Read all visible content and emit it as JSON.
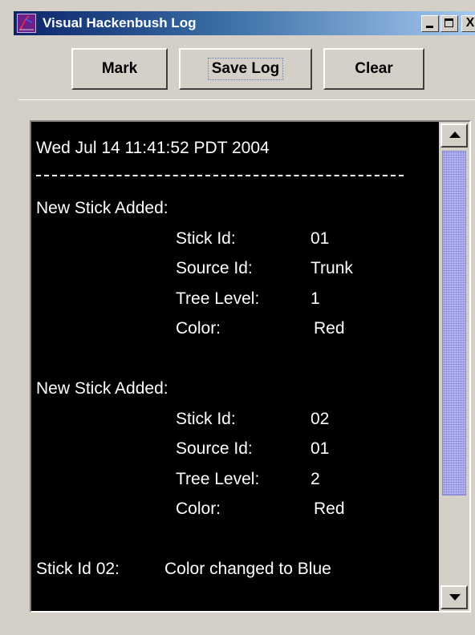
{
  "window": {
    "title": "Visual Hackenbush Log",
    "controls": {
      "minimize": "_",
      "maximize": "□",
      "close": "X"
    },
    "icon": "app-icon"
  },
  "toolbar": {
    "mark_label": "Mark",
    "save_label": "Save Log",
    "clear_label": "Clear"
  },
  "log": {
    "timestamp": "Wed Jul 14 11:41:52 PDT 2004",
    "entries": [
      {
        "heading": "New Stick Added:",
        "fields": [
          {
            "label": "Stick Id:",
            "value": "01"
          },
          {
            "label": "Source Id:",
            "value": "Trunk"
          },
          {
            "label": "Tree Level:",
            "value": "1"
          },
          {
            "label": "Color:",
            "value": "Red"
          }
        ]
      },
      {
        "heading": "New Stick Added:",
        "fields": [
          {
            "label": "Stick Id:",
            "value": "02"
          },
          {
            "label": "Source Id:",
            "value": "01"
          },
          {
            "label": "Tree Level:",
            "value": "2"
          },
          {
            "label": "Color:",
            "value": "Red"
          }
        ]
      }
    ],
    "change_prefix": "Stick Id 02:",
    "change_text": "Color changed to Blue"
  },
  "colors": {
    "log_background": "#000000",
    "log_text": "#ffffff",
    "titlebar_start": "#0a246a",
    "titlebar_end": "#a6caf0",
    "scroll_thumb": "#b8b8f0"
  }
}
